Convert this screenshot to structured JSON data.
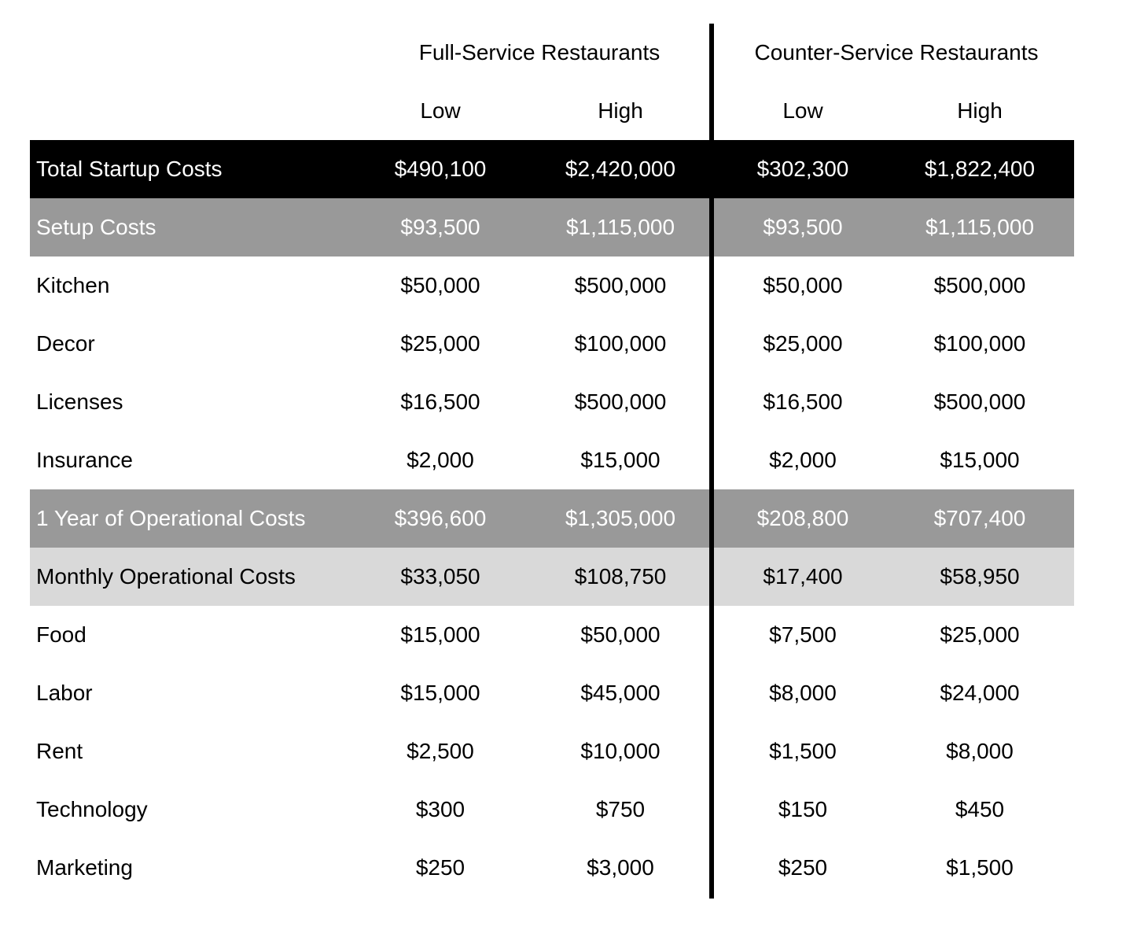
{
  "table": {
    "groups": {
      "full_service": "Full-Service Restaurants",
      "counter_service": "Counter-Service Restaurants"
    },
    "columns": {
      "full_low": "Low",
      "full_high": "High",
      "counter_low": "Low",
      "counter_high": "High"
    },
    "rows": [
      {
        "label": "Total Startup Costs",
        "style": "total",
        "full_low": "$490,100",
        "full_high": "$2,420,000",
        "counter_low": "$302,300",
        "counter_high": "$1,822,400"
      },
      {
        "label": "Setup Costs",
        "style": "section",
        "full_low": "$93,500",
        "full_high": "$1,115,000",
        "counter_low": "$93,500",
        "counter_high": "$1,115,000"
      },
      {
        "label": "Kitchen",
        "style": "item",
        "full_low": "$50,000",
        "full_high": "$500,000",
        "counter_low": "$50,000",
        "counter_high": "$500,000"
      },
      {
        "label": "Decor",
        "style": "item",
        "full_low": "$25,000",
        "full_high": "$100,000",
        "counter_low": "$25,000",
        "counter_high": "$100,000"
      },
      {
        "label": "Licenses",
        "style": "item",
        "full_low": "$16,500",
        "full_high": "$500,000",
        "counter_low": "$16,500",
        "counter_high": "$500,000"
      },
      {
        "label": "Insurance",
        "style": "item",
        "full_low": "$2,000",
        "full_high": "$15,000",
        "counter_low": "$2,000",
        "counter_high": "$15,000"
      },
      {
        "label": "1 Year of Operational Costs",
        "style": "section",
        "full_low": "$396,600",
        "full_high": "$1,305,000",
        "counter_low": "$208,800",
        "counter_high": "$707,400"
      },
      {
        "label": "Monthly Operational Costs",
        "style": "subtotal",
        "full_low": "$33,050",
        "full_high": "$108,750",
        "counter_low": "$17,400",
        "counter_high": "$58,950"
      },
      {
        "label": "Food",
        "style": "item",
        "full_low": "$15,000",
        "full_high": "$50,000",
        "counter_low": "$7,500",
        "counter_high": "$25,000"
      },
      {
        "label": "Labor",
        "style": "item",
        "full_low": "$15,000",
        "full_high": "$45,000",
        "counter_low": "$8,000",
        "counter_high": "$24,000"
      },
      {
        "label": "Rent",
        "style": "item",
        "full_low": "$2,500",
        "full_high": "$10,000",
        "counter_low": "$1,500",
        "counter_high": "$8,000"
      },
      {
        "label": "Technology",
        "style": "item",
        "full_low": "$300",
        "full_high": "$750",
        "counter_low": "$150",
        "counter_high": "$450"
      },
      {
        "label": "Marketing",
        "style": "item",
        "full_low": "$250",
        "full_high": "$3,000",
        "counter_low": "$250",
        "counter_high": "$1,500"
      }
    ]
  },
  "colors": {
    "total_bg": "#000000",
    "section_bg": "#999999",
    "subtotal_bg": "#d9d9d9",
    "divider": "#000000"
  }
}
